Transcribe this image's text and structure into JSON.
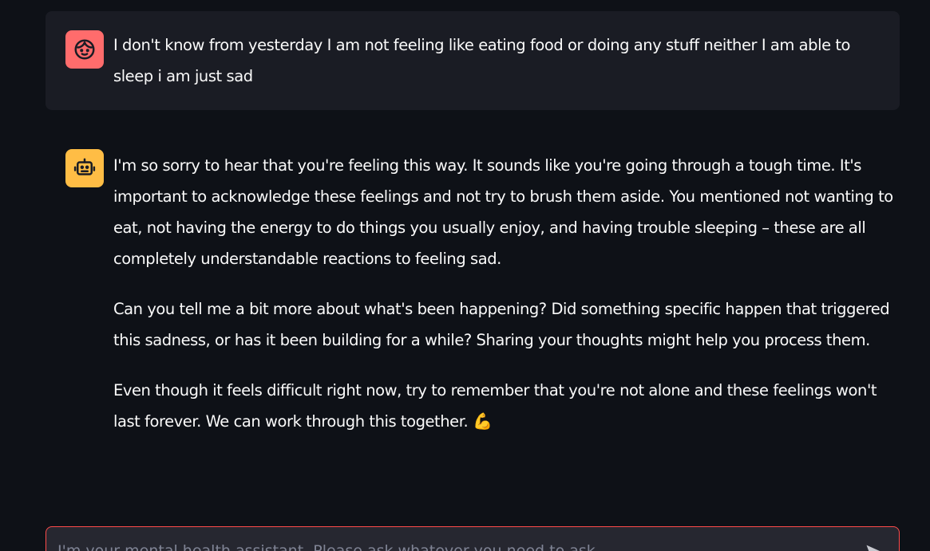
{
  "messages": {
    "user": {
      "avatar_icon": "face-icon",
      "avatar_color": "#ff6c6c",
      "text": "I don't know from yesterday I am not feeling like eating food or doing any stuff neither I am able to sleep i am just sad"
    },
    "assistant": {
      "avatar_icon": "robot-icon",
      "avatar_color": "#ffbd45",
      "paragraphs": [
        "I'm so sorry to hear that you're feeling this way. It sounds like you're going through a tough time. It's important to acknowledge these feelings and not try to brush them aside. You mentioned not wanting to eat, not having the energy to do things you usually enjoy, and having trouble sleeping – these are all completely understandable reactions to feeling sad.",
        "Can you tell me a bit more about what's been happening? Did something specific happen that triggered this sadness, or has it been building for a while? Sharing your thoughts might help you process them.",
        "Even though it feels difficult right now, try to remember that you're not alone and these feelings won't last forever. We can work through this together."
      ],
      "emoji": "💪"
    }
  },
  "chat_input": {
    "placeholder": "I'm your mental health assistant. Please ask whatever you need to ask",
    "value": "",
    "border_color": "#ff4b4b",
    "send_icon": "send-icon"
  }
}
